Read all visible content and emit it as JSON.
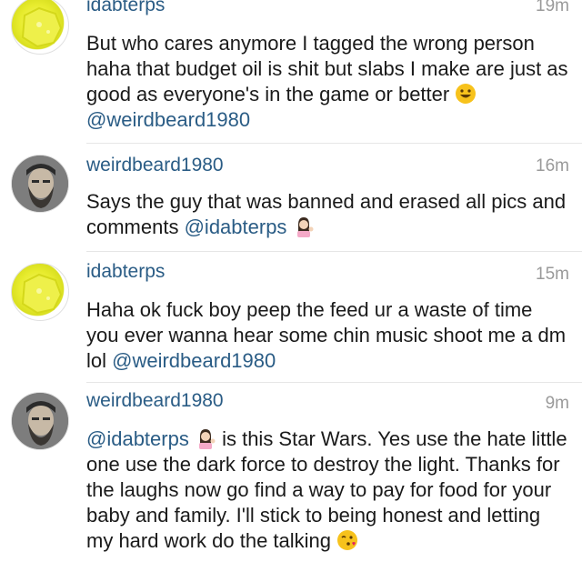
{
  "comments": [
    {
      "username": "idabterps",
      "time": "19m",
      "avatar": "wax-slab-avatar",
      "text_before": "But who cares anymore I tagged the wrong person haha that budget oil is shit but slabs I make are just as good as everyone's in the game or better ",
      "emoji": "grinning-face-emoji",
      "mention": "@weirdbeard1980",
      "text_after": ""
    },
    {
      "username": "weirdbeard1980",
      "time": "16m",
      "avatar": "bearded-man-avatar",
      "text_before": "Says the guy that was banned and erased all pics and comments ",
      "mention": "@idabterps",
      "emoji": "person-tipping-hand-emoji",
      "text_after": ""
    },
    {
      "username": "idabterps",
      "time": "15m",
      "avatar": "wax-slab-avatar",
      "text_before": "Haha ok fuck boy peep the feed ur a waste of time you ever wanna hear some chin music shoot me a dm lol ",
      "mention": "@weirdbeard1980",
      "text_after": ""
    },
    {
      "username": "weirdbeard1980",
      "time": "9m",
      "avatar": "bearded-man-avatar",
      "mention": "@idabterps",
      "emoji": "person-tipping-hand-emoji",
      "text_after": " is this Star Wars. Yes use the hate little one use the dark force to destroy the light. Thanks for the laughs now go find a way to pay for food for your baby and family. I'll stick to being honest and letting my hard work do the talking ",
      "emoji_end": "face-blowing-kiss-emoji"
    }
  ],
  "colors": {
    "username": "#2a5c85",
    "mention": "#2a5c85",
    "time": "#9a9a9a",
    "text": "#1a1a1a",
    "divider": "#e6e6e6"
  }
}
